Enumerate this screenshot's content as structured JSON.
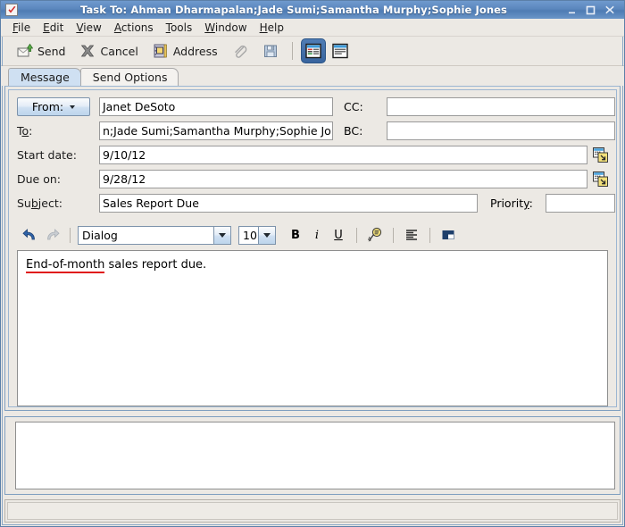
{
  "window": {
    "title": "Task To: Ahman Dharmapalan;Jade Sumi;Samantha Murphy;Sophie Jones",
    "app_icon": "red-check-icon",
    "controls": {
      "minimize": "minimize-icon",
      "maximize": "maximize-icon",
      "close": "close-icon"
    },
    "accent": "#4f7cb4",
    "face": "#ece9e4"
  },
  "menubar": {
    "items": [
      {
        "label": "File",
        "mnemonic": "F"
      },
      {
        "label": "Edit",
        "mnemonic": "E"
      },
      {
        "label": "View",
        "mnemonic": "V"
      },
      {
        "label": "Actions",
        "mnemonic": "A"
      },
      {
        "label": "Tools",
        "mnemonic": "T"
      },
      {
        "label": "Window",
        "mnemonic": "W"
      },
      {
        "label": "Help",
        "mnemonic": "H"
      }
    ]
  },
  "toolbar": {
    "send_label": "Send",
    "send_icon": "send-mail-icon",
    "cancel_label": "Cancel",
    "cancel_icon": "cancel-x-icon",
    "address_label": "Address",
    "address_icon": "address-book-icon",
    "attach_icon": "paperclip-icon",
    "save_icon": "floppy-save-icon",
    "view_compact_icon": "view-compact-icon",
    "view_detail_icon": "view-detail-icon",
    "selected_view": "view-compact-icon"
  },
  "tabs": {
    "items": [
      {
        "label": "Message",
        "active": true
      },
      {
        "label": "Send Options",
        "active": false
      }
    ]
  },
  "form": {
    "from_button": "From:",
    "from_value": "Janet DeSoto",
    "cc_label": "CC:",
    "cc_value": "",
    "cc_placeholder": "",
    "to_label": "To:",
    "to_mnemonic": "o",
    "to_value": "n;Jade Sumi;Samantha Murphy;Sophie Jones",
    "bc_label": "BC:",
    "bc_value": "",
    "bc_placeholder": "",
    "start_date_label": "Start date:",
    "start_date_value": "9/10/12",
    "due_on_label": "Due on:",
    "due_on_value": "9/28/12",
    "subject_label": "Subject:",
    "subject_mnemonic": "b",
    "subject_value": "Sales Report Due",
    "priority_label": "Priority:",
    "priority_mnemonic": "y",
    "priority_value": "",
    "calendar_icon": "calendar-picker-icon"
  },
  "format_toolbar": {
    "undo_icon": "undo-arrow-icon",
    "redo_icon": "redo-arrow-icon",
    "font_family": "Dialog",
    "font_size": "10",
    "bold_label": "B",
    "italic_label": "i",
    "underline_label": "U",
    "spellcheck_icon": "spellcheck-icon",
    "align_icon": "align-left-icon",
    "insert_object_icon": "insert-object-icon"
  },
  "body": {
    "misspelled_word": "End-of-month",
    "rest_text": " sales report due."
  },
  "lower_pane": {
    "content": ""
  },
  "statusbar": {
    "text": ""
  }
}
